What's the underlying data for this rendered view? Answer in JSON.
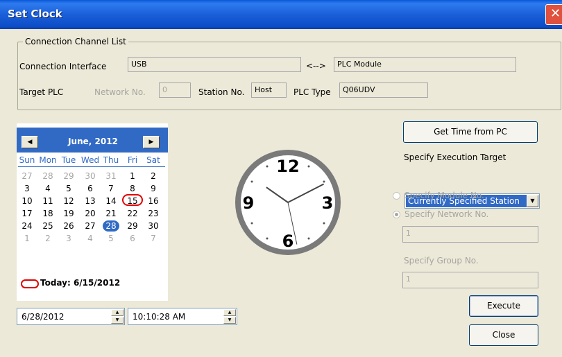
{
  "window": {
    "title": "Set Clock",
    "close_glyph": "✕"
  },
  "connection": {
    "group_label": "Connection Channel List",
    "interface_label": "Connection Interface",
    "interface_value": "USB",
    "arrow": "<-->",
    "target_value": "PLC Module",
    "target_plc_label": "Target PLC",
    "network_label": "Network No.",
    "network_value": "0",
    "station_label": "Station No.",
    "station_value": "Host",
    "plc_type_label": "PLC Type",
    "plc_type_value": "Q06UDV"
  },
  "calendar": {
    "month_label": "June, 2012",
    "prev_glyph": "◀",
    "next_glyph": "▶",
    "days_of_week": [
      "Sun",
      "Mon",
      "Tue",
      "Wed",
      "Thu",
      "Fri",
      "Sat"
    ],
    "weeks": [
      [
        "27",
        "28",
        "29",
        "30",
        "31",
        "1",
        "2"
      ],
      [
        "3",
        "4",
        "5",
        "6",
        "7",
        "8",
        "9"
      ],
      [
        "10",
        "11",
        "12",
        "13",
        "14",
        "15",
        "16"
      ],
      [
        "17",
        "18",
        "19",
        "20",
        "21",
        "22",
        "23"
      ],
      [
        "24",
        "25",
        "26",
        "27",
        "28",
        "29",
        "30"
      ],
      [
        "1",
        "2",
        "3",
        "4",
        "5",
        "6",
        "7"
      ]
    ],
    "selected_day": "28",
    "today_day": "15",
    "today_text": "Today: 6/15/2012",
    "accent_color": "#316ac5",
    "today_mark_color": "#e00000"
  },
  "date_field": {
    "value": "6/28/2012"
  },
  "time_field": {
    "value": "10:10:28 AM"
  },
  "clock": {
    "numerals": {
      "n12": "12",
      "n3": "3",
      "n6": "6",
      "n9": "9"
    },
    "hour": 10,
    "minute": 10,
    "second": 28
  },
  "spin": {
    "up": "▲",
    "down": "▼"
  },
  "controls": {
    "get_time_button": "Get Time from PC",
    "execution_target_label": "Specify Execution Target",
    "execution_target_value": "Currently Specified Station",
    "dropdown_arrow": "▼",
    "module_radio_label": "Specify Module No.",
    "network_radio_label": "Specify Network No.",
    "network_no_value": "1",
    "group_label": "Specify Group No.",
    "group_value": "1",
    "execute_button": "Execute",
    "close_button": "Close"
  }
}
